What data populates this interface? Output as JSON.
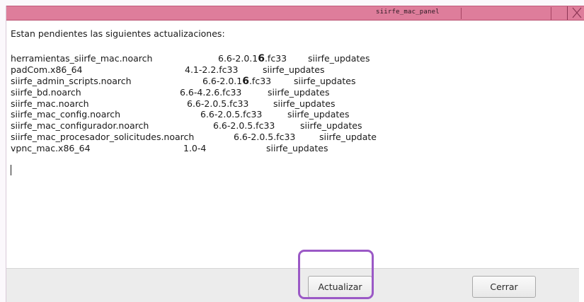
{
  "window": {
    "title": "siirfe_mac_panel"
  },
  "content": {
    "intro": "Estan pendientes las siguientes actualizaciones:",
    "updates": [
      {
        "package": "herramientas_siirfe_mac.noarch",
        "version_prefix": "6.6-2.0.1",
        "version_bold": "6",
        "version_suffix": ".fc33",
        "repo": "siirfe_updates"
      },
      {
        "package": "padCom.x86_64",
        "version_prefix": "4.1-2.2.fc33",
        "version_bold": "",
        "version_suffix": "",
        "repo": "siirfe_updates"
      },
      {
        "package": "siirfe_admin_scripts.noarch",
        "version_prefix": "6.6-2.0.1",
        "version_bold": "6",
        "version_suffix": ".fc33",
        "repo": "siirfe_updates"
      },
      {
        "package": "siirfe_bd.noarch",
        "version_prefix": "6.6-4.2.6.fc33",
        "version_bold": "",
        "version_suffix": "",
        "repo": "siirfe_updates"
      },
      {
        "package": "siirfe_mac.noarch",
        "version_prefix": "6.6-2.0.5.fc33",
        "version_bold": "",
        "version_suffix": "",
        "repo": "siirfe_updates"
      },
      {
        "package": "siirfe_mac_config.noarch",
        "version_prefix": "6.6-2.0.5.fc33",
        "version_bold": "",
        "version_suffix": "",
        "repo": "siirfe_updates"
      },
      {
        "package": "siirfe_mac_configurador.noarch",
        "version_prefix": "6.6-2.0.5.fc33",
        "version_bold": "",
        "version_suffix": "",
        "repo": "siirfe_updates"
      },
      {
        "package": "siirfe_mac_procesador_solicitudes.noarch",
        "version_prefix": "6.6-2.0.5.fc33",
        "version_bold": "",
        "version_suffix": "",
        "repo": "siirfe_update"
      },
      {
        "package": "vpnc_mac.x86_64",
        "version_prefix": "1.0-4",
        "version_bold": "",
        "version_suffix": "",
        "repo": "siirfe_updates"
      }
    ]
  },
  "buttons": {
    "update_label": "Actualizar",
    "close_label": "Cerrar"
  },
  "colors": {
    "titlebar": "#de7d9b",
    "highlight": "#9b59c6"
  }
}
